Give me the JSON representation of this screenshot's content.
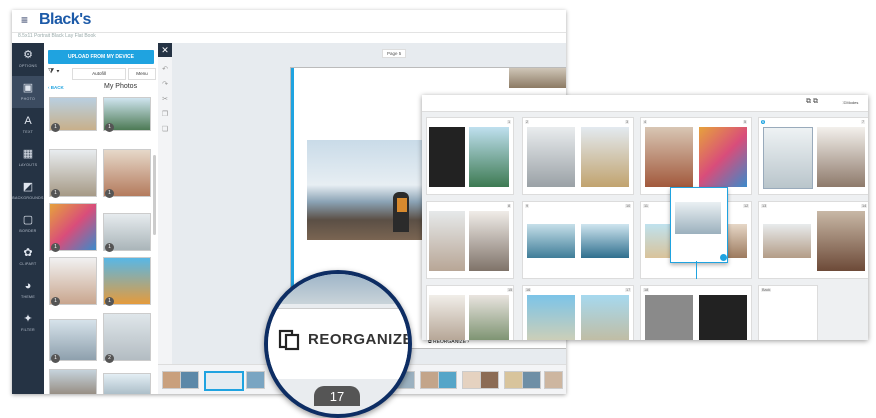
{
  "app": {
    "logo": "Black's",
    "subtitle": "8.5x11 Portrait Black Lay Flat Book"
  },
  "sidebar": {
    "items": [
      {
        "label": "OPTIONS",
        "icon": "sliders-icon"
      },
      {
        "label": "PHOTO",
        "icon": "photo-icon"
      },
      {
        "label": "TEXT",
        "icon": "text-icon"
      },
      {
        "label": "LAYOUTS",
        "icon": "layout-icon"
      },
      {
        "label": "BACKGROUNDS",
        "icon": "background-icon"
      },
      {
        "label": "BORDER",
        "icon": "border-icon"
      },
      {
        "label": "CLIPART",
        "icon": "clipart-icon"
      },
      {
        "label": "THEME",
        "icon": "palette-icon"
      },
      {
        "label": "FILTER",
        "icon": "sparkle-icon"
      }
    ]
  },
  "panel": {
    "upload_label": "UPLOAD FROM MY DEVICE",
    "autofill_label": "Autofill",
    "menu_label": "Menu",
    "back_label": "BACK",
    "title": "My Photos",
    "badges": [
      "1",
      "1",
      "1",
      "1",
      "1",
      "1",
      "1",
      "1",
      "1",
      "2"
    ]
  },
  "canvas": {
    "page_label": "Page 5"
  },
  "grid": {
    "toolbar_label": "Modes",
    "page_numbers": [
      "1",
      "2",
      "3",
      "4",
      "5",
      "6",
      "7",
      "8",
      "9",
      "10",
      "11",
      "12",
      "13",
      "14",
      "15",
      "16",
      "17",
      "18",
      "19",
      "20",
      "21",
      "22",
      "23",
      "24"
    ],
    "last_label": "Back"
  },
  "magnifier": {
    "label": "REORGANIZE",
    "page_number": "17"
  },
  "strip": {
    "reorganize_label": "REORGANIZE"
  },
  "colors": {
    "accent": "#1fa3e0",
    "sidebar": "#253344",
    "brand": "#1c5aa8",
    "ring": "#0d2d63"
  }
}
